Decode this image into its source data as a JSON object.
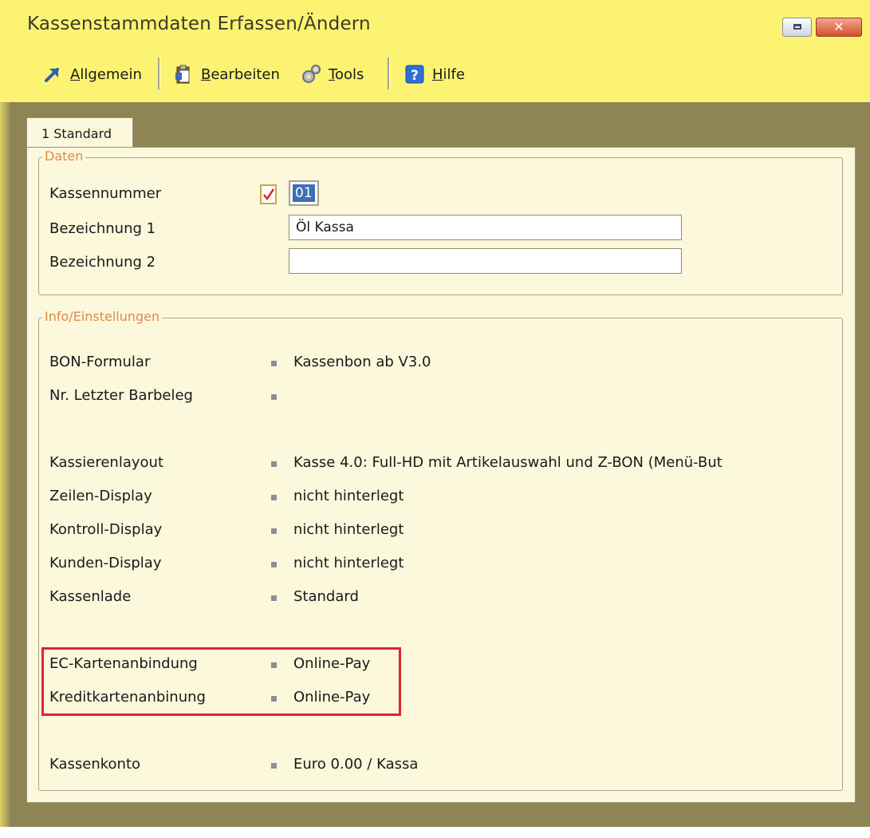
{
  "window": {
    "title": "Kassenstammdaten Erfassen/Ändern",
    "controls": [
      "restore-icon",
      "close-icon"
    ],
    "close_glyph": "✕"
  },
  "toolbar": {
    "items": [
      {
        "label_underlined": "A",
        "label_rest": "llgemein",
        "icon": "arrow-icon"
      },
      {
        "label_underlined": "B",
        "label_rest": "earbeiten",
        "icon": "clipboard-icon"
      },
      {
        "label_underlined": "T",
        "label_rest": "ools",
        "icon": "gears-icon"
      },
      {
        "label_underlined": "H",
        "label_rest": "ilfe",
        "icon": "help-icon"
      }
    ],
    "save_icon": "save-icon"
  },
  "tab": {
    "label": "1 Standard"
  },
  "daten": {
    "legend": "Daten",
    "fields": [
      {
        "label": "Kassennummer",
        "value": "01"
      },
      {
        "label": "Bezeichnung 1",
        "value": "Öl Kassa"
      },
      {
        "label": "Bezeichnung 2",
        "value": ""
      }
    ]
  },
  "info": {
    "legend": "Info/Einstellungen",
    "rows": [
      {
        "label": "BON-Formular",
        "value": "Kassenbon ab V3.0"
      },
      {
        "label": "Nr. Letzter Barbeleg",
        "value": ""
      },
      {
        "label": "Kassierenlayout",
        "value": "Kasse 4.0: Full-HD mit Artikelauswahl und Z-BON (Menü-But"
      },
      {
        "label": "Zeilen-Display",
        "value": "nicht hinterlegt"
      },
      {
        "label": "Kontroll-Display",
        "value": "nicht hinterlegt"
      },
      {
        "label": "Kunden-Display",
        "value": "nicht hinterlegt"
      },
      {
        "label": "Kassenlade",
        "value": "Standard"
      },
      {
        "label": "EC-Kartenanbindung",
        "value": "Online-Pay"
      },
      {
        "label": "Kreditkartenanbinung",
        "value": "Online-Pay"
      },
      {
        "label": "Kassenkonto",
        "value": "Euro 0.00 / Kassa"
      }
    ]
  },
  "colors": {
    "titlebar": "#fcf373",
    "panel": "#fbf8dc",
    "legend_text": "#e08a4a",
    "highlight": "#e0242c",
    "selection": "#3d6fb6"
  }
}
